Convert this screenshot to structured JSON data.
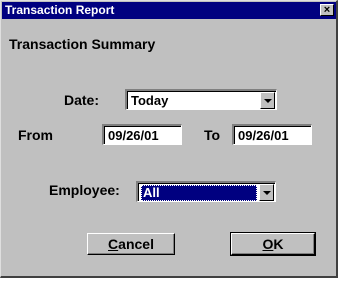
{
  "window": {
    "title": "Transaction Report",
    "close_glyph": "×"
  },
  "heading": "Transaction Summary",
  "date": {
    "label": "Date:",
    "value": "Today"
  },
  "from": {
    "label": "From",
    "value": "09/26/01"
  },
  "to": {
    "label": "To",
    "value": "09/26/01"
  },
  "employee": {
    "label": "Employee:",
    "value": "All"
  },
  "buttons": {
    "cancel": {
      "mnemonic": "C",
      "rest": "ancel"
    },
    "ok": {
      "mnemonic": "O",
      "rest": "K"
    }
  },
  "colors": {
    "titlebar": "#000080",
    "face": "#c0c0c0",
    "selection": "#000080"
  },
  "icons": {
    "close": "close-icon",
    "dropdown": "chevron-down-icon"
  }
}
